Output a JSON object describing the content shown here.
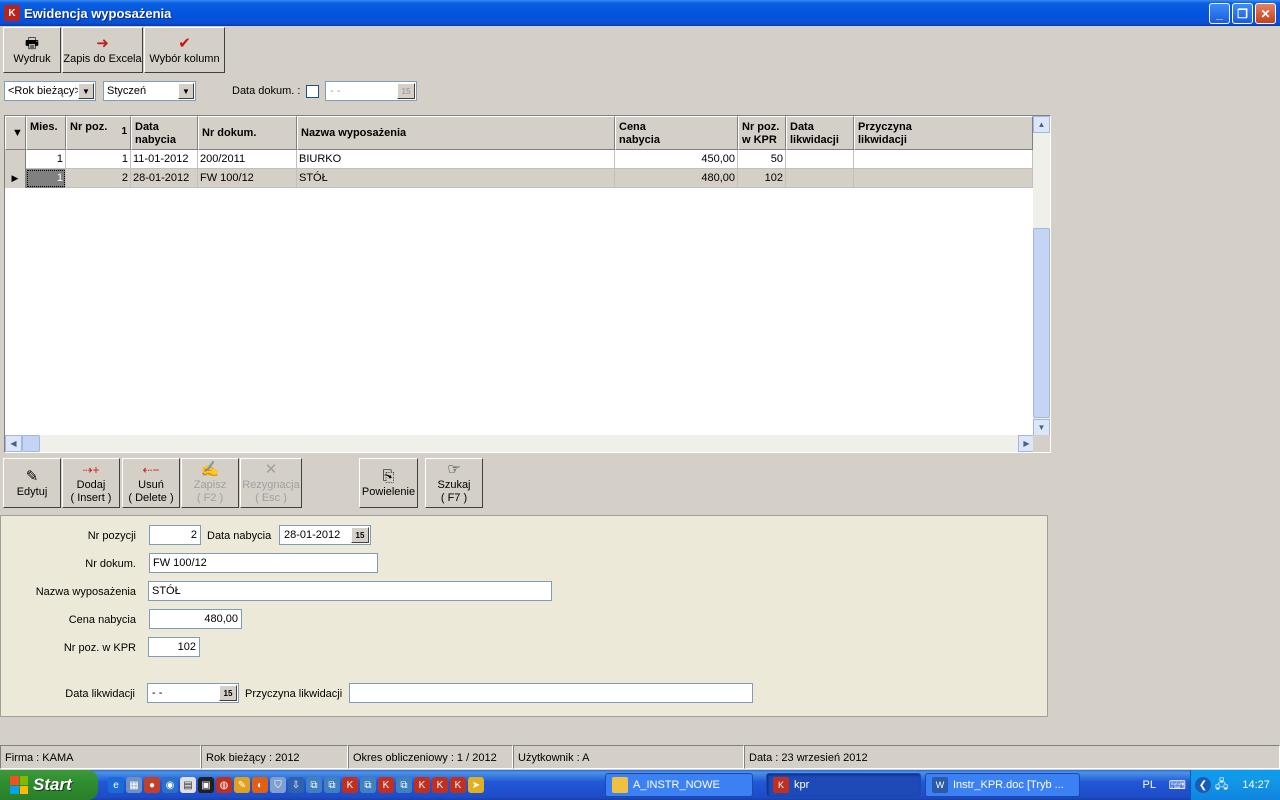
{
  "window": {
    "title": "Ewidencja wyposażenia",
    "app_icon_glyph": "K"
  },
  "toolbar": {
    "print_label": "Wydruk",
    "excel_label": "Zapis do Excela",
    "columns_label": "Wybór kolumn"
  },
  "filters": {
    "year_value": "<Rok bieżący>",
    "month_value": "Styczeń",
    "doc_date_label": "Data dokum. :",
    "doc_date_value": "- -",
    "cal_icon": "15"
  },
  "grid": {
    "columns": [
      {
        "l1": "Mies.",
        "l2": ""
      },
      {
        "l1": "Nr poz.",
        "l2": ""
      },
      {
        "l1": "Data",
        "l2": "nabycia"
      },
      {
        "l1": "Nr dokum.",
        "l2": ""
      },
      {
        "l1": "Nazwa wyposażenia",
        "l2": ""
      },
      {
        "l1": "Cena",
        "l2": "nabycia"
      },
      {
        "l1": "Nr poz.",
        "l2": "w KPR"
      },
      {
        "l1": "Data",
        "l2": "likwidacji"
      },
      {
        "l1": "Przyczyna",
        "l2": "likwidacji"
      }
    ],
    "sort_mark": "1",
    "rows": [
      {
        "mies": "1",
        "nrpoz": "1",
        "data": "11-01-2012",
        "nrdok": "200/2011",
        "nazwa": "BIURKO",
        "cena": "450,00",
        "kpr": "50",
        "dlik": "",
        "plik": ""
      },
      {
        "mies": "1",
        "nrpoz": "2",
        "data": "28-01-2012",
        "nrdok": "FW 100/12",
        "nazwa": "STÓŁ",
        "cena": "480,00",
        "kpr": "102",
        "dlik": "",
        "plik": ""
      }
    ]
  },
  "actions": {
    "edit": "Edytuj",
    "add_1": "Dodaj",
    "add_2": "( Insert )",
    "delete_1": "Usuń",
    "delete_2": "( Delete )",
    "save_1": "Zapisz",
    "save_2": "( F2 )",
    "cancel_1": "Rezygnacja",
    "cancel_2": "( Esc )",
    "duplicate": "Powielenie",
    "search_1": "Szukaj",
    "search_2": "( F7 )"
  },
  "form": {
    "nr_pozycji_label": "Nr pozycji",
    "nr_pozycji": "2",
    "data_nabycia_label": "Data nabycia",
    "data_nabycia": "28-01-2012",
    "nr_dokum_label": "Nr dokum.",
    "nr_dokum": "FW 100/12",
    "nazwa_label": "Nazwa wyposażenia",
    "nazwa": "STÓŁ",
    "cena_label": "Cena nabycia",
    "cena": "480,00",
    "kpr_label": "Nr poz. w KPR",
    "kpr": "102",
    "data_lik_label": "Data likwidacji",
    "data_lik": "- -",
    "przyczyna_label": "Przyczyna likwidacji",
    "przyczyna": ""
  },
  "status": {
    "firma": "Firma : KAMA",
    "rok": "Rok bieżący : 2012",
    "okres": "Okres obliczeniowy : 1 / 2012",
    "uzytkownik": "Użytkownik : A",
    "data": "Data : 23 wrzesień 2012"
  },
  "taskbar": {
    "start_label": "Start",
    "tasks": [
      {
        "label": "A_INSTR_NOWE"
      },
      {
        "label": "kpr"
      },
      {
        "label": "Instr_KPR.doc [Tryb ..."
      }
    ],
    "lang": "PL",
    "clock": "14:27"
  },
  "colors": {
    "title_blue": "#0554e0",
    "face": "#d4d0c8",
    "panel": "#ece9d8",
    "start_green": "#2f8e2f"
  }
}
